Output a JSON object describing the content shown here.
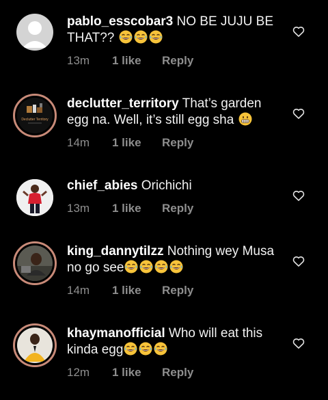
{
  "comments": [
    {
      "username": "pablo_esscobar3",
      "text": "NO BE JUJU BE THAT??",
      "emojis": [
        "laugh",
        "laugh",
        "laugh"
      ],
      "time": "13m",
      "likes": "1 like",
      "reply": "Reply"
    },
    {
      "username": "declutter_territory",
      "text": "That’s garden egg na. Well, it’s still egg sha",
      "emojis": [
        "grin"
      ],
      "avatar_text": "Declutter Territory",
      "time": "14m",
      "likes": "1 like",
      "reply": "Reply"
    },
    {
      "username": "chief_abies",
      "text": "Orichichi",
      "emojis": [],
      "time": "13m",
      "likes": "1 like",
      "reply": "Reply"
    },
    {
      "username": "king_dannytilzz",
      "text": "Nothing wey Musa no go see",
      "emojis": [
        "laugh",
        "laugh",
        "laugh",
        "laugh"
      ],
      "time": "14m",
      "likes": "1 like",
      "reply": "Reply"
    },
    {
      "username": "khaymanofficial",
      "text": "Who will eat this kinda egg",
      "emojis": [
        "laugh",
        "laugh",
        "laugh"
      ],
      "time": "12m",
      "likes": "1 like",
      "reply": "Reply"
    }
  ],
  "colors": {
    "background": "#000000",
    "meta": "#8e8e8e",
    "story_ring": "#c88a78"
  },
  "icons": {
    "like": "heart-outline-icon",
    "laugh": "face-with-tears-of-joy",
    "grin": "grinning-face"
  }
}
